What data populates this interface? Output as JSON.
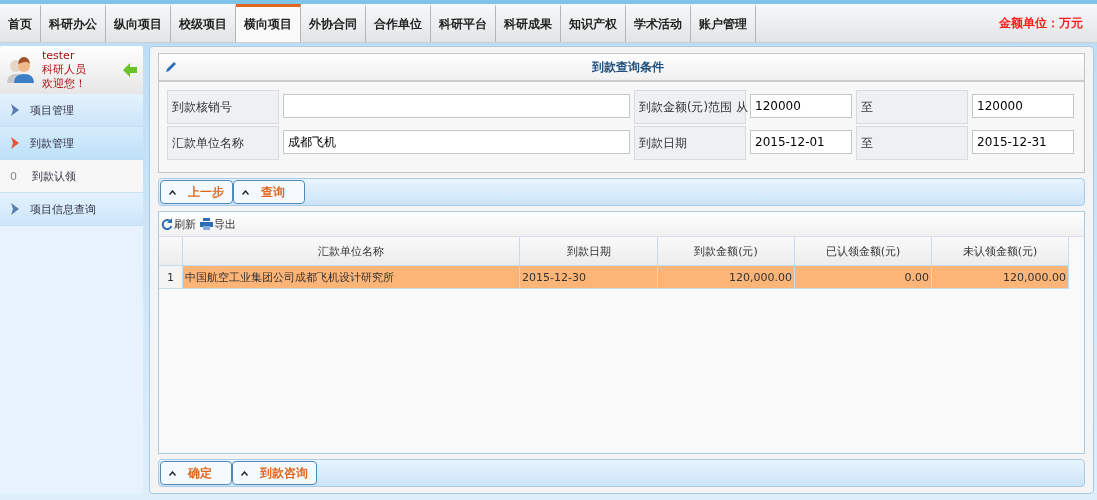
{
  "nav": {
    "tabs": [
      {
        "label": "首页",
        "selected": false
      },
      {
        "label": "科研办公",
        "selected": false
      },
      {
        "label": "纵向项目",
        "selected": false
      },
      {
        "label": "校级项目",
        "selected": false
      },
      {
        "label": "横向项目",
        "selected": true
      },
      {
        "label": "外协合同",
        "selected": false
      },
      {
        "label": "合作单位",
        "selected": false
      },
      {
        "label": "科研平台",
        "selected": false
      },
      {
        "label": "科研成果",
        "selected": false
      },
      {
        "label": "知识产权",
        "selected": false
      },
      {
        "label": "学术活动",
        "selected": false
      },
      {
        "label": "账户管理",
        "selected": false
      }
    ],
    "unit_note": "金额单位：万元"
  },
  "user": {
    "name": "tester",
    "role": "科研人员",
    "greeting": "欢迎您！"
  },
  "sidebar": {
    "items": [
      {
        "kind": "group",
        "label": "项目管理",
        "selected": false
      },
      {
        "kind": "group",
        "label": "到款管理",
        "selected": true
      },
      {
        "kind": "sub",
        "count": "0",
        "label": "到款认领",
        "selected": false
      },
      {
        "kind": "group",
        "label": "项目信息查询",
        "selected": false
      }
    ]
  },
  "query_form": {
    "title": "到款查询条件",
    "rows": [
      [
        {
          "label": "到款核销号"
        },
        {
          "label": "到款金额(元)范围 从",
          "value": "120000"
        },
        {
          "label": "至",
          "value": "120000"
        }
      ],
      [
        {
          "label": "汇款单位名称",
          "value": "成都飞机"
        },
        {
          "label": "到款日期",
          "value": "2015-12-01"
        },
        {
          "label": "至",
          "value": "2015-12-31"
        }
      ]
    ],
    "buttons": [
      "上一步",
      "查询"
    ]
  },
  "grid": {
    "toolbar": [
      "刷新",
      "导出"
    ],
    "columns": [
      "汇款单位名称",
      "到款日期",
      "到款金额(元)",
      "已认领金额(元)",
      "未认领金额(元)"
    ],
    "rows": [
      {
        "index": "1",
        "selected": true,
        "cells": [
          "中国航空工业集团公司成都飞机设计研究所",
          "2015-12-30",
          "120,000.00",
          "0.00",
          "120,000.00"
        ]
      }
    ],
    "buttons": [
      "确定",
      "到款咨询"
    ]
  }
}
